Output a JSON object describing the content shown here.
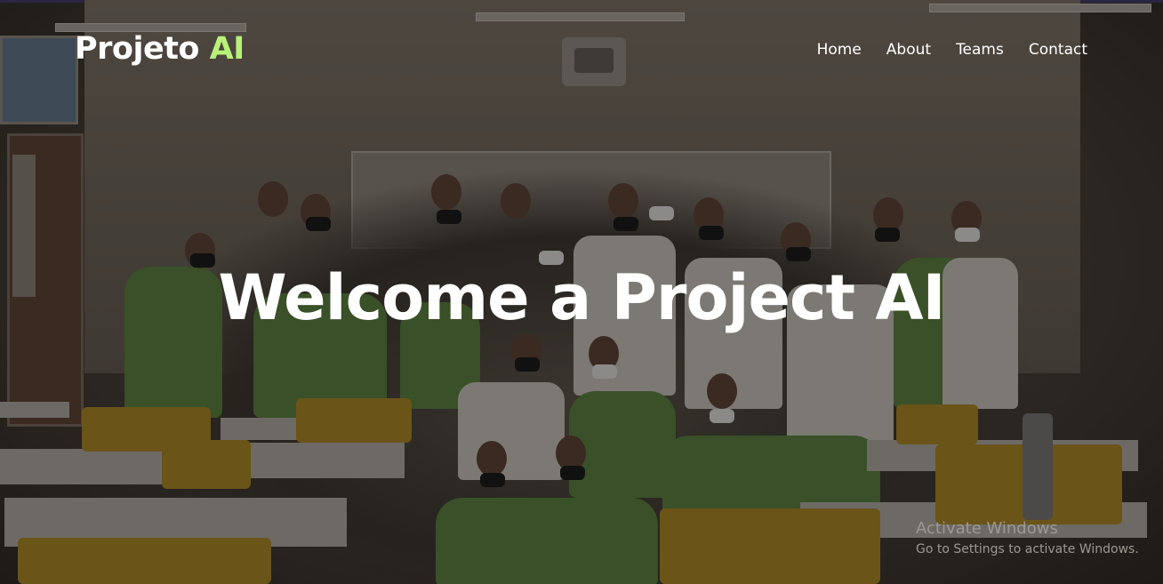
{
  "brand": {
    "text": "Projeto ",
    "accent": "AI"
  },
  "nav": {
    "items": [
      {
        "label": "Home"
      },
      {
        "label": "About"
      },
      {
        "label": "Teams"
      },
      {
        "label": "Contact"
      }
    ]
  },
  "hero": {
    "title": "Welcome a Project AI"
  },
  "watermark": {
    "title": "Activate Windows",
    "subtitle": "Go to Settings to activate Windows."
  },
  "colors": {
    "accent": "#b8f17a",
    "text": "#ffffff",
    "overlay": "#1a1714"
  }
}
